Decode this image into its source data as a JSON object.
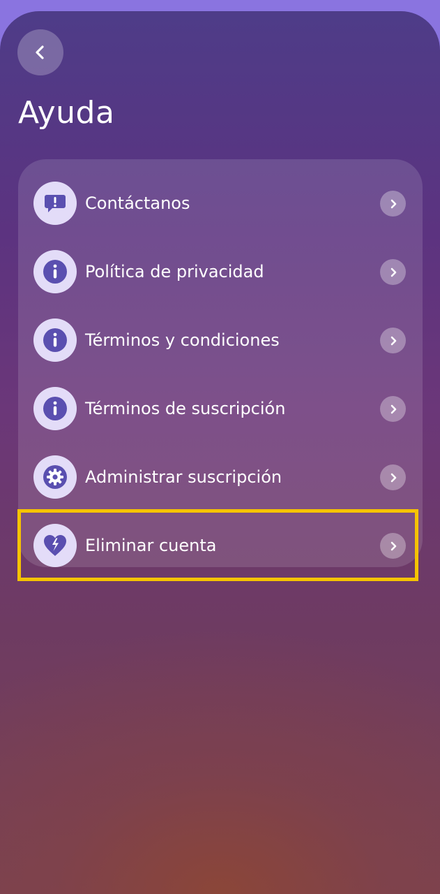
{
  "header": {
    "back_icon": "chevron-left-icon",
    "title": "Ayuda"
  },
  "menu": {
    "items": [
      {
        "label": "Contáctanos",
        "icon": "message-alert-icon"
      },
      {
        "label": "Política de privacidad",
        "icon": "info-icon"
      },
      {
        "label": "Términos y condiciones",
        "icon": "info-icon"
      },
      {
        "label": "Términos de suscripción",
        "icon": "info-icon"
      },
      {
        "label": "Administrar suscripción",
        "icon": "gear-icon"
      },
      {
        "label": "Eliminar cuenta",
        "icon": "broken-heart-icon"
      }
    ],
    "chevron_icon": "chevron-right-icon"
  },
  "highlight": {
    "target": "Eliminar cuenta",
    "color": "#f6c300"
  },
  "colors": {
    "icon_fill": "#5a4fb0",
    "icon_bg": "#e3dcf8",
    "text": "#ffffff"
  }
}
